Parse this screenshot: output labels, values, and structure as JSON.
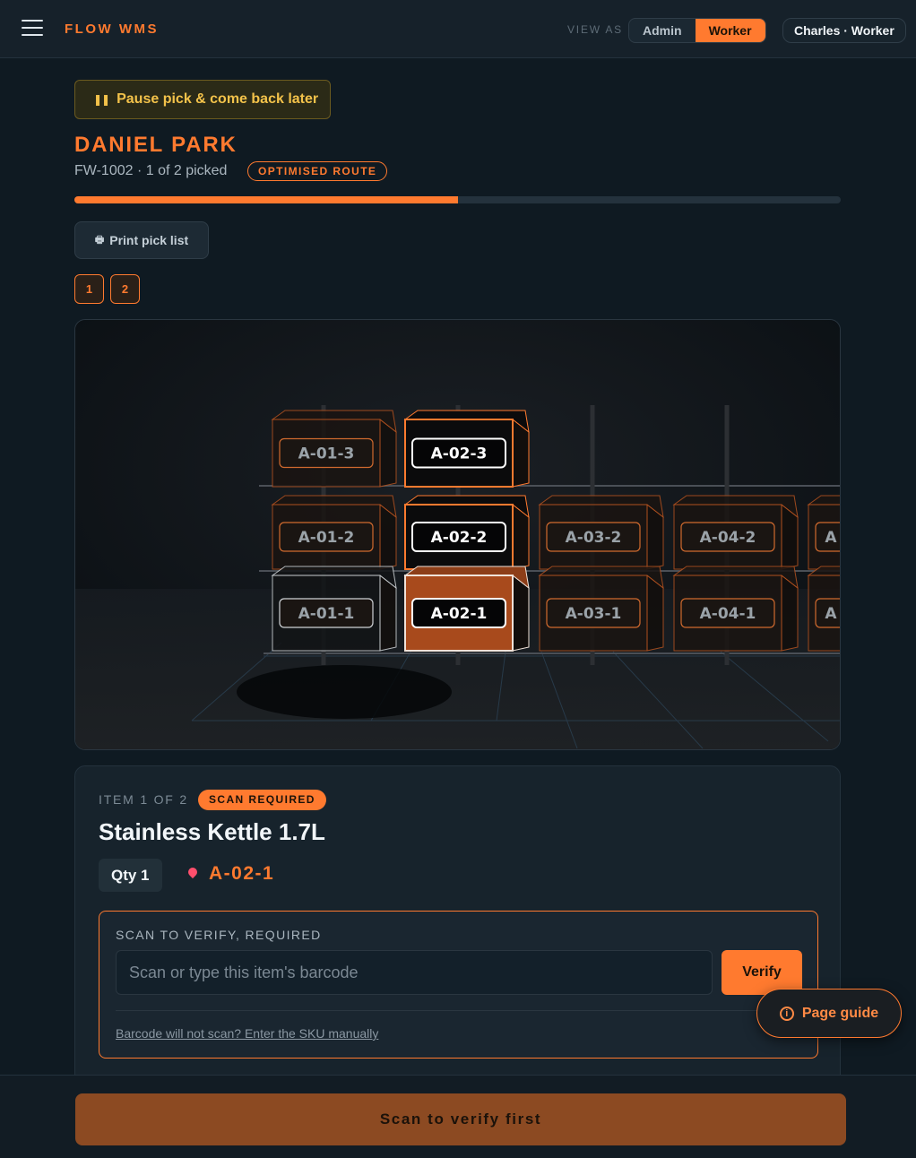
{
  "header": {
    "brand": "FLOW WMS",
    "view_as_label": "VIEW AS",
    "view_options": [
      "Admin",
      "Worker"
    ],
    "selected_view": "Worker",
    "user_chip": "Charles · Worker"
  },
  "pick": {
    "pause_label": "Pause pick & come back later",
    "customer": "DANIEL PARK",
    "order_meta": "FW-1002 · 1 of 2 picked",
    "route_badge": "OPTIMISED ROUTE",
    "progress_fraction": 0.5,
    "print_label": "Print pick list",
    "steps": [
      "1",
      "2"
    ]
  },
  "rack": {
    "rows": [
      [
        "A-01-3",
        "A-02-3"
      ],
      [
        "A-01-2",
        "A-02-2",
        "A-03-2",
        "A-04-2",
        "A"
      ],
      [
        "A-01-1",
        "A-02-1",
        "A-03-1",
        "A-04-1",
        "A"
      ]
    ],
    "target_location": "A-02-1"
  },
  "item": {
    "kicker": "ITEM 1 OF 2",
    "scan_badge": "SCAN REQUIRED",
    "title": "Stainless Kettle 1.7L",
    "qty": "Qty 1",
    "location": "A-02-1",
    "verify_label": "SCAN TO VERIFY, REQUIRED",
    "input_placeholder": "Scan or type this item's barcode",
    "verify_button": "Verify",
    "manual_link": "Barcode will not scan? Enter the SKU manually"
  },
  "guide_label": "Page guide",
  "footer_button": "Scan to verify first",
  "colors": {
    "accent": "#ff7a2f",
    "background": "#0f1a22",
    "pin": "#ff4f6d"
  }
}
